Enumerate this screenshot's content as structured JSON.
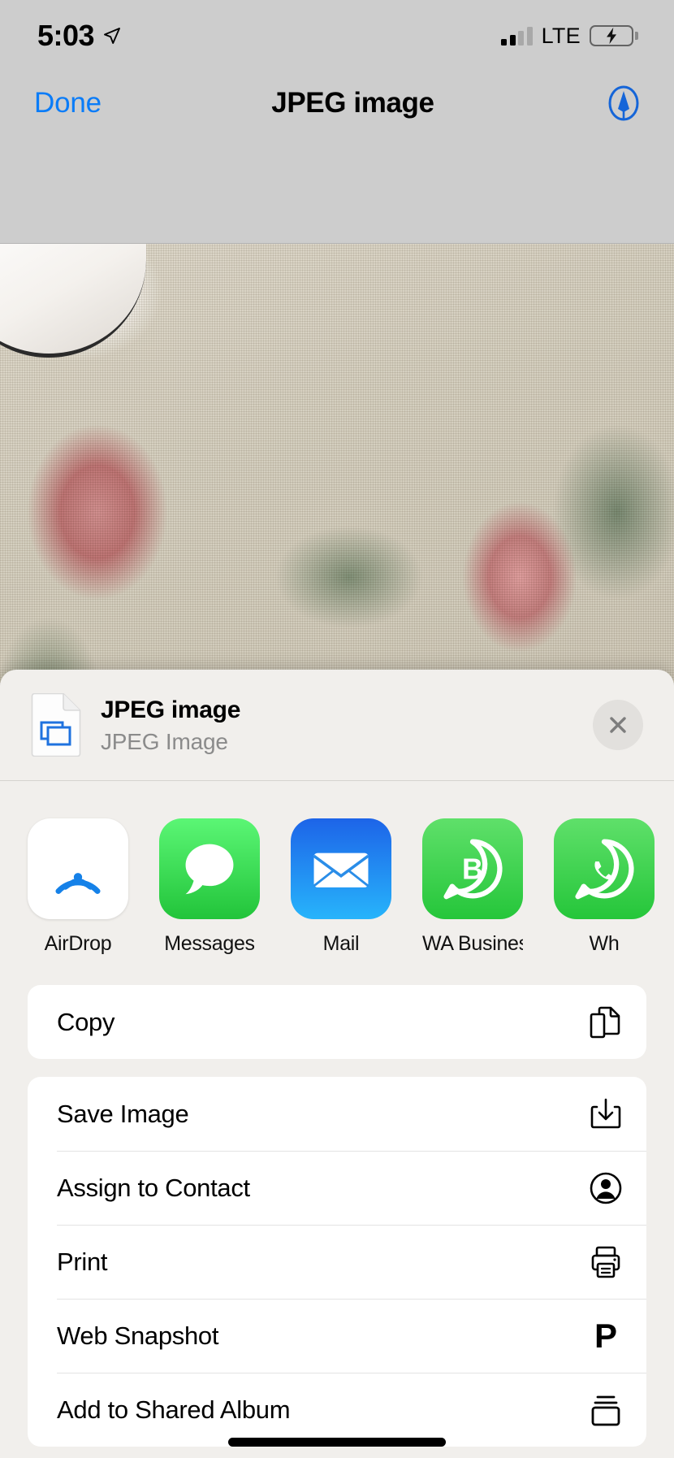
{
  "status_bar": {
    "time": "5:03",
    "location_icon": "location-arrow-icon",
    "signal_bars_filled": 2,
    "signal_bars_total": 4,
    "carrier": "LTE",
    "battery_icon": "battery-charging-icon",
    "battery_color": "#4cd455"
  },
  "nav_bar": {
    "done_label": "Done",
    "title": "JPEG image",
    "markup_icon": "markup-pen-icon",
    "accent_color": "#0a7cf8"
  },
  "share_sheet": {
    "file": {
      "icon": "jpeg-document-icon",
      "title": "JPEG image",
      "subtitle": "JPEG Image",
      "close_icon": "close-icon"
    },
    "apps": [
      {
        "label": "AirDrop",
        "icon": "airdrop-icon"
      },
      {
        "label": "Messages",
        "icon": "messages-icon"
      },
      {
        "label": "Mail",
        "icon": "mail-icon"
      },
      {
        "label": "WA Business",
        "icon": "whatsapp-business-icon"
      },
      {
        "label": "Wh",
        "icon": "whatsapp-icon"
      }
    ],
    "action_groups": [
      {
        "items": [
          {
            "label": "Copy",
            "icon": "copy-icon"
          }
        ]
      },
      {
        "items": [
          {
            "label": "Save Image",
            "icon": "save-download-icon"
          },
          {
            "label": "Assign to Contact",
            "icon": "contact-person-icon"
          },
          {
            "label": "Print",
            "icon": "printer-icon"
          },
          {
            "label": "Web Snapshot",
            "icon": "web-snapshot-p-icon"
          },
          {
            "label": "Add to Shared Album",
            "icon": "shared-album-icon"
          }
        ]
      }
    ]
  }
}
